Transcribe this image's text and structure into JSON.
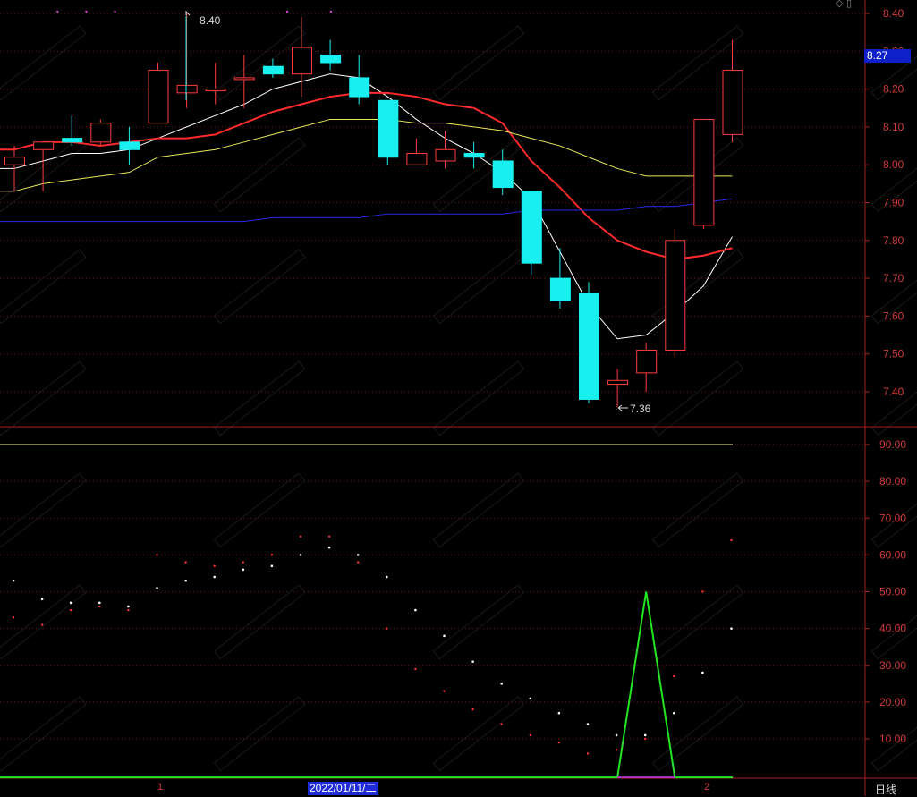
{
  "chart_data": [
    {
      "type": "candlestick",
      "period_label": "日线",
      "current_price_label": "8.27",
      "date_cursor_label": "2022/01/11/二",
      "month_markers": [
        "1",
        "2"
      ],
      "high_annotation": "8.40",
      "low_annotation": "7.36",
      "ylim": [
        7.3,
        8.45
      ],
      "yticks": [
        "8.40",
        "8.30",
        "8.20",
        "8.10",
        "8.00",
        "7.90",
        "7.80",
        "7.70",
        "7.60",
        "7.50",
        "7.40"
      ],
      "candles": [
        {
          "o": 8.0,
          "h": 8.05,
          "l": 7.93,
          "c": 8.02
        },
        {
          "o": 8.04,
          "h": 8.06,
          "l": 7.93,
          "c": 8.06
        },
        {
          "o": 8.07,
          "h": 8.13,
          "l": 8.05,
          "c": 8.06
        },
        {
          "o": 8.06,
          "h": 8.12,
          "l": 8.05,
          "c": 8.11
        },
        {
          "o": 8.06,
          "h": 8.1,
          "l": 8.0,
          "c": 8.04
        },
        {
          "o": 8.11,
          "h": 8.27,
          "l": 8.11,
          "c": 8.25
        },
        {
          "o": 8.19,
          "h": 8.4,
          "l": 8.15,
          "c": 8.21
        },
        {
          "o": 8.2,
          "h": 8.27,
          "l": 8.16,
          "c": 8.2
        },
        {
          "o": 8.23,
          "h": 8.29,
          "l": 8.15,
          "c": 8.23
        },
        {
          "o": 8.26,
          "h": 8.28,
          "l": 8.23,
          "c": 8.24
        },
        {
          "o": 8.24,
          "h": 8.39,
          "l": 8.18,
          "c": 8.31
        },
        {
          "o": 8.29,
          "h": 8.33,
          "l": 8.25,
          "c": 8.27
        },
        {
          "o": 8.23,
          "h": 8.29,
          "l": 8.16,
          "c": 8.18
        },
        {
          "o": 8.17,
          "h": 8.17,
          "l": 8.0,
          "c": 8.02
        },
        {
          "o": 8.0,
          "h": 8.07,
          "l": 8.0,
          "c": 8.03
        },
        {
          "o": 8.01,
          "h": 8.09,
          "l": 7.99,
          "c": 8.04
        },
        {
          "o": 8.03,
          "h": 8.06,
          "l": 7.99,
          "c": 8.02
        },
        {
          "o": 8.01,
          "h": 8.04,
          "l": 7.92,
          "c": 7.94
        },
        {
          "o": 7.93,
          "h": 7.93,
          "l": 7.71,
          "c": 7.74
        },
        {
          "o": 7.7,
          "h": 7.78,
          "l": 7.62,
          "c": 7.64
        },
        {
          "o": 7.66,
          "h": 7.69,
          "l": 7.37,
          "c": 7.38
        },
        {
          "o": 7.42,
          "h": 7.46,
          "l": 7.36,
          "c": 7.43
        },
        {
          "o": 7.45,
          "h": 7.53,
          "l": 7.4,
          "c": 7.51
        },
        {
          "o": 7.51,
          "h": 7.83,
          "l": 7.49,
          "c": 7.8
        },
        {
          "o": 7.84,
          "h": 8.12,
          "l": 7.83,
          "c": 8.12
        },
        {
          "o": 8.08,
          "h": 8.33,
          "l": 8.06,
          "c": 8.25
        }
      ],
      "top_markers": [
        3,
        4,
        5,
        11
      ],
      "ma_lines": [
        {
          "color": "#ffffff",
          "width": 1,
          "values": [
            7.99,
            8.01,
            8.03,
            8.03,
            8.04,
            8.07,
            8.1,
            8.13,
            8.16,
            8.2,
            8.22,
            8.24,
            8.23,
            8.18,
            8.12,
            8.07,
            8.03,
            7.98,
            7.91,
            7.77,
            7.63,
            7.54,
            7.55,
            7.61,
            7.68,
            7.81
          ]
        },
        {
          "color": "#ff2a2a",
          "width": 2,
          "values": [
            8.04,
            8.06,
            8.06,
            8.05,
            8.06,
            8.07,
            8.07,
            8.08,
            8.11,
            8.14,
            8.16,
            8.18,
            8.19,
            8.19,
            8.18,
            8.16,
            8.15,
            8.11,
            8.01,
            7.94,
            7.86,
            7.8,
            7.77,
            7.75,
            7.76,
            7.78
          ]
        },
        {
          "color": "#e8e85a",
          "width": 1,
          "values": [
            7.93,
            7.95,
            7.96,
            7.97,
            7.98,
            8.02,
            8.03,
            8.04,
            8.06,
            8.08,
            8.1,
            8.12,
            8.12,
            8.12,
            8.11,
            8.11,
            8.1,
            8.09,
            8.07,
            8.05,
            8.02,
            7.99,
            7.97,
            7.97,
            7.97,
            7.97
          ]
        },
        {
          "color": "#2a2ae8",
          "width": 1,
          "values": [
            7.85,
            7.85,
            7.85,
            7.85,
            7.85,
            7.85,
            7.85,
            7.85,
            7.85,
            7.86,
            7.86,
            7.86,
            7.86,
            7.87,
            7.87,
            7.87,
            7.87,
            7.87,
            7.88,
            7.88,
            7.88,
            7.88,
            7.89,
            7.89,
            7.9,
            7.91
          ]
        }
      ]
    },
    {
      "type": "indicator",
      "ylim": [
        0,
        95
      ],
      "yticks": [
        "90.00",
        "80.00",
        "70.00",
        "60.00",
        "50.00",
        "40.00",
        "30.00",
        "20.00",
        "10.00"
      ],
      "reference_line": 90,
      "white_dots": [
        53,
        48,
        47,
        47,
        46,
        51,
        53,
        54,
        56,
        57,
        60,
        62,
        60,
        54,
        45,
        38,
        31,
        25,
        21,
        17,
        14,
        11,
        11,
        17,
        28,
        40
      ],
      "red_dots": [
        43,
        41,
        45,
        46,
        45,
        60,
        58,
        57,
        58,
        60,
        65,
        65,
        58,
        40,
        29,
        23,
        18,
        14,
        11,
        9,
        6,
        7,
        10,
        27,
        50,
        64
      ],
      "green_line": [
        0,
        0,
        0,
        0,
        0,
        0,
        0,
        0,
        0,
        0,
        0,
        0,
        0,
        0,
        0,
        0,
        0,
        0,
        0,
        0,
        0,
        0,
        50,
        0,
        0,
        0
      ],
      "magenta_baseline": [
        21,
        23
      ]
    }
  ]
}
